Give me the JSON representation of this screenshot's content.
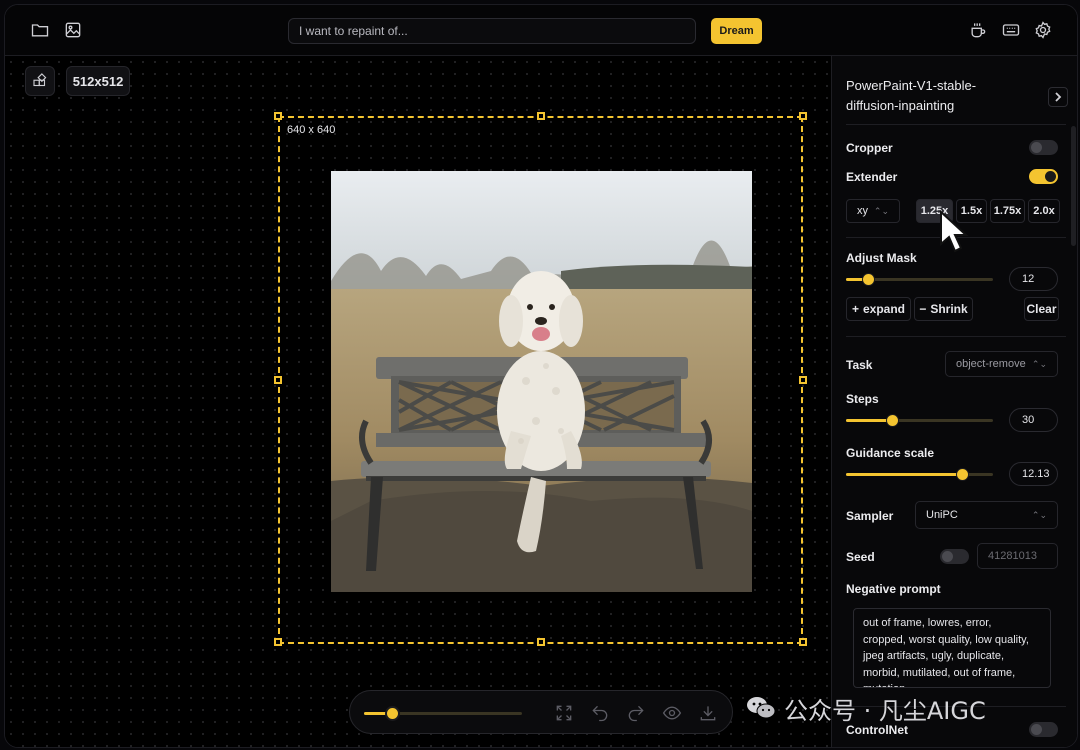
{
  "topbar": {
    "prompt_placeholder": "I want to repaint of...",
    "dream_label": "Dream"
  },
  "canvas": {
    "size_button": "512x512",
    "outpaint_size_label": "640 x 640"
  },
  "bottom_toolbar": {
    "brush_size_percent": 18
  },
  "panel": {
    "model_name": "PowerPaint-V1-stable-diffusion-inpainting",
    "cropper_label": "Cropper",
    "cropper_on": false,
    "extender_label": "Extender",
    "extender_on": true,
    "direction_select": "xy",
    "scale_options": [
      "1.25x",
      "1.5x",
      "1.75x",
      "2.0x"
    ],
    "scale_selected": "1.25x",
    "adjust_mask_label": "Adjust Mask",
    "adjust_mask_value": "12",
    "expand_label": "expand",
    "shrink_label": "Shrink",
    "clear_label": "Clear",
    "task_label": "Task",
    "task_value": "object-remove",
    "steps_label": "Steps",
    "steps_value": "30",
    "guidance_label": "Guidance scale",
    "guidance_value": "12.13",
    "sampler_label": "Sampler",
    "sampler_value": "UniPC",
    "seed_label": "Seed",
    "seed_on": false,
    "seed_value": "41281013",
    "negative_prompt_label": "Negative prompt",
    "negative_prompt_text": "out of frame, lowres, error, cropped, worst quality, low quality, jpeg artifacts, ugly, duplicate, morbid, mutilated, out of frame, mutation",
    "controlnet_label": "ControlNet",
    "controlnet_on": false
  },
  "watermark": {
    "text": "公众号 · 凡尘AIGC"
  },
  "colors": {
    "accent": "#f4c430",
    "background": "#000000",
    "panel": "#08080a"
  }
}
